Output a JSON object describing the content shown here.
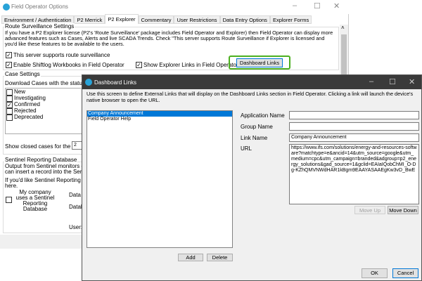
{
  "main_window": {
    "title": "Field Operator Options",
    "tabs": [
      "Environment / Authentication",
      "P2 Merrick",
      "P2 Explorer",
      "Commentary",
      "User Restrictions",
      "Data Entry Options",
      "Explorer Forms"
    ],
    "route": {
      "group_label": "Route Surveillance Settings",
      "description": [
        "If you have a P2 Explorer license (P2's 'Route Surveillance' package includes Field Operator and Explorer) then Field Operator can display more",
        "advanced features such as Cases, Alerts and live SCADA Trends.  Check \"This server supports Route Surveillance if Explorer is licensed and",
        "you'd like these features to be available to the users."
      ],
      "supports_route_surveillance": "This server supports route surveillance",
      "enable_shiftlog": "Enable Shiftlog Workbooks in Field Operator",
      "show_explorer_links": "Show Explorer Links in Field Operator",
      "dashboard_links_button": "Dashboard Links"
    },
    "cases": {
      "group_label": "Case Settings",
      "download_label": "Download Cases with the status of:",
      "statuses": [
        {
          "label": "New",
          "checked": false
        },
        {
          "label": "Investigating",
          "checked": false
        },
        {
          "label": "Confirmed",
          "checked": true
        },
        {
          "label": "Rejected",
          "checked": false
        },
        {
          "label": "Deprecated",
          "checked": false
        }
      ],
      "show_closed_label": "Show closed cases for the last",
      "show_closed_value": "2"
    },
    "sentinel": {
      "group_label": "Sentinel Reporting Database",
      "text1": "Output from Sentinel monitors can flo",
      "text2": "can insert a record into the Sentinel R",
      "text3": "If you'd like Sentinel Reporting recor",
      "text4": "here.",
      "uses_db_label": "My company uses a Sentinel Reporting Database",
      "data_source_label": "Data S",
      "database_label": "Databa",
      "user_label": "User:"
    }
  },
  "dialog": {
    "title": "Dashboard Links",
    "description": "Use this screen to define External Links that will display on the Dashboard Links section in Field Operator.  Clicking a link will launch the device's native browser to open the URL.",
    "links": [
      "Company Announcement",
      "Field Operator Help"
    ],
    "selected_index": 0,
    "application_name_label": "Application Name",
    "application_name_value": "",
    "group_name_label": "Group Name",
    "group_name_value": "",
    "link_name_label": "Link Name",
    "link_name_value": "Company Announcement",
    "url_label": "URL",
    "url_value": "https://www.ifs.com/solutions/energy-and-resources-software?matchtype=e&ancid=14&utm_source=google&utm_medium=cpc&utm_campaign=branded&adgroup=p2_energy_solutions&gad_source=1&gclid=EAIaIQobChMI_O-Dg-KZhQMVNWdHAR1kBgm9EAAYASAAEgKw3vD_BwE",
    "add": "Add",
    "delete": "Delete",
    "move_up": "Move Up",
    "move_down": "Move Down",
    "ok": "OK",
    "cancel": "Cancel"
  },
  "colors": {
    "highlight": "#4caf20",
    "selection": "#0078d7",
    "dialog_title": "#3a3a3a"
  }
}
